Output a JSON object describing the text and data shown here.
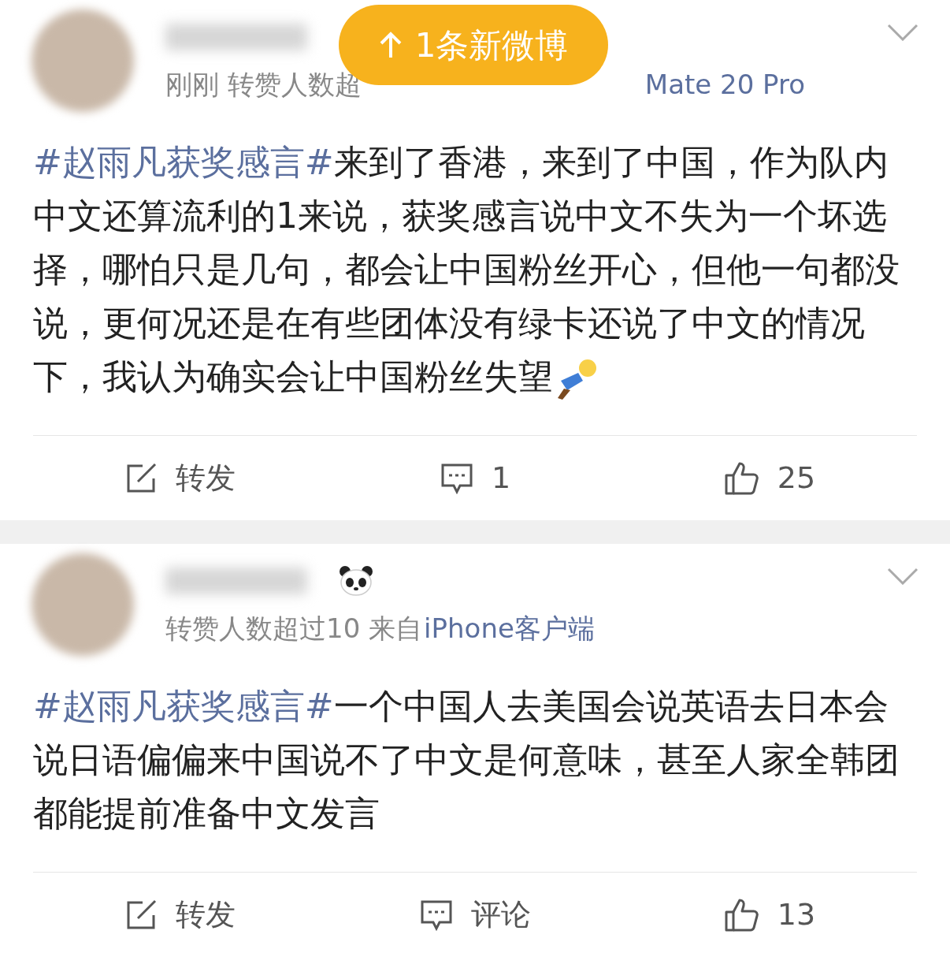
{
  "toast": {
    "label": "1条新微博"
  },
  "posts": [
    {
      "meta": "刚刚 转赞人数超",
      "source": "Mate 20 Pro",
      "badge": false,
      "body": [
        {
          "kind": "hashtag",
          "text": "#赵雨凡获奖感言#"
        },
        {
          "kind": "text",
          "text": "来到了香港，来到了中国，作为队内中文还算流利的1来说，获奖感言说中文不失为一个坏选择，哪怕只是几句，都会让中国粉丝开心，但他一句都没说，更何况还是在有些团体没有绿卡还说了中文的情况下，我认为确实会让中国粉丝失望"
        },
        {
          "kind": "emoji"
        }
      ],
      "actions": [
        {
          "kind": "repost",
          "label": "转发"
        },
        {
          "kind": "comment",
          "label": "1"
        },
        {
          "kind": "like",
          "label": "25"
        }
      ]
    },
    {
      "meta": "转赞人数超过10 来自",
      "source": "iPhone客户端",
      "badge": true,
      "body": [
        {
          "kind": "hashtag",
          "text": "#赵雨凡获奖感言#"
        },
        {
          "kind": "text",
          "text": "一个中国人去美国会说英语去日本会说日语偏偏来中国说不了中文是何意味，甚至人家全韩团都能提前准备中文发言"
        }
      ],
      "actions": [
        {
          "kind": "repost",
          "label": "转发"
        },
        {
          "kind": "comment",
          "label": "评论"
        },
        {
          "kind": "like",
          "label": "13"
        }
      ]
    }
  ]
}
